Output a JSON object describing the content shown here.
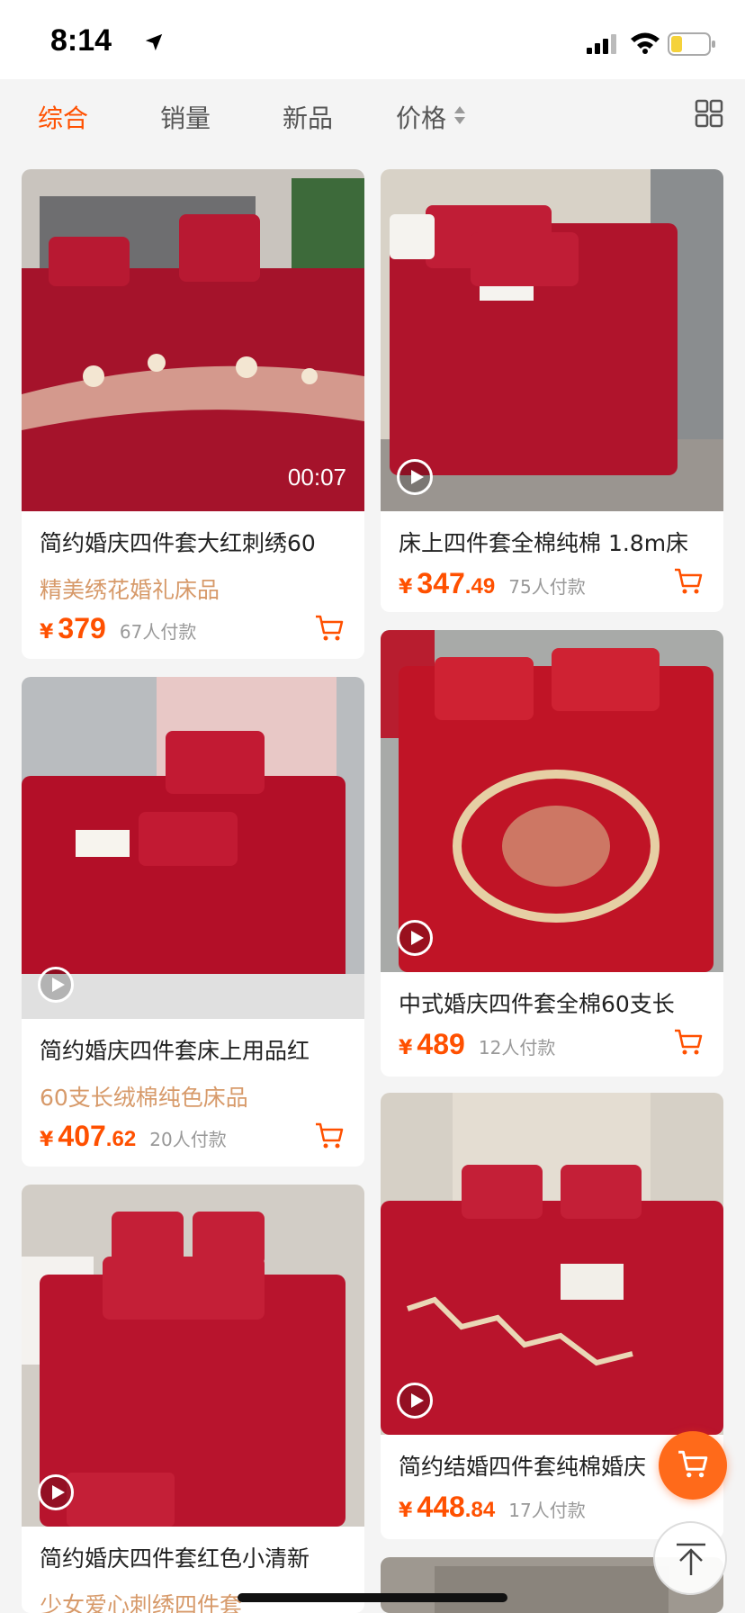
{
  "status_bar": {
    "time": "8:14"
  },
  "tabs": [
    {
      "label": "综合",
      "active": true
    },
    {
      "label": "销量",
      "active": false
    },
    {
      "label": "新品",
      "active": false
    },
    {
      "label": "价格",
      "active": false
    }
  ],
  "colors": {
    "accent": "#ff5000",
    "subtitle": "#d79a6a",
    "product_red": "#b3122a"
  },
  "products": [
    {
      "title": "简约婚庆四件套大红刺绣60",
      "subtitle": "精美绣花婚礼床品",
      "price_int": "379",
      "price_dec": "",
      "sold": "67人付款",
      "duration": "00:07",
      "has_video": true
    },
    {
      "title": "床上四件套全棉纯棉 1.8m床",
      "subtitle": "",
      "price_int": "347",
      "price_dec": ".49",
      "sold": "75人付款",
      "duration": "",
      "has_video": true
    },
    {
      "title": "简约婚庆四件套床上用品红",
      "subtitle": "60支长绒棉纯色床品",
      "price_int": "407",
      "price_dec": ".62",
      "sold": "20人付款",
      "duration": "",
      "has_video": true
    },
    {
      "title": "中式婚庆四件套全棉60支长",
      "subtitle": "",
      "price_int": "489",
      "price_dec": "",
      "sold": "12人付款",
      "duration": "",
      "has_video": true
    },
    {
      "title": "简约婚庆四件套红色小清新",
      "subtitle": "少女爱心刺绣四件套",
      "price_int": "",
      "price_dec": "",
      "sold": "",
      "duration": "",
      "has_video": true
    },
    {
      "title": "简约结婚四件套纯棉婚庆",
      "subtitle": "",
      "price_int": "448",
      "price_dec": ".84",
      "sold": "17人付款",
      "duration": "",
      "has_video": true
    }
  ],
  "currency_symbol": "¥"
}
